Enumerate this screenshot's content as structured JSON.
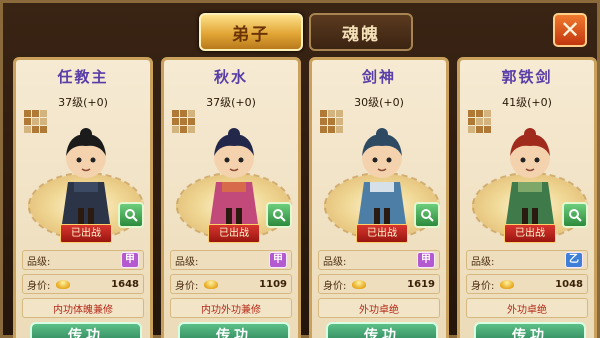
{
  "tabs": [
    {
      "label": "弟子",
      "active": true
    },
    {
      "label": "魂魄",
      "active": false
    }
  ],
  "close_label": "✕",
  "labels": {
    "grade": "品级:",
    "price": "身价:",
    "deployed": "已出战",
    "pass_button": "传功"
  },
  "disciples": [
    {
      "name": "任教主",
      "level": "37级(+0)",
      "grade": "甲",
      "grade_color": "#b45ad0",
      "price": "1648",
      "skill": "内功体魄兼修",
      "robe": "#2c3448",
      "hair": "#1b1b1b",
      "accent": "#3d4a63"
    },
    {
      "name": "秋水",
      "level": "37级(+0)",
      "grade": "甲",
      "grade_color": "#b45ad0",
      "price": "1109",
      "skill": "内功外功兼修",
      "robe": "#c24a7a",
      "hair": "#23274a",
      "accent": "#d66a4a"
    },
    {
      "name": "剑神",
      "level": "30级(+0)",
      "grade": "甲",
      "grade_color": "#b45ad0",
      "price": "1619",
      "skill": "外功卓绝",
      "robe": "#4d7fa6",
      "hair": "#2e4a63",
      "accent": "#d6e0e8"
    },
    {
      "name": "郭铁剑",
      "level": "41级(+0)",
      "grade": "乙",
      "grade_color": "#3f7fd8",
      "price": "1048",
      "skill": "外功卓绝",
      "robe": "#3e7a4a",
      "hair": "#a02a1c",
      "accent": "#7ea86a"
    }
  ]
}
